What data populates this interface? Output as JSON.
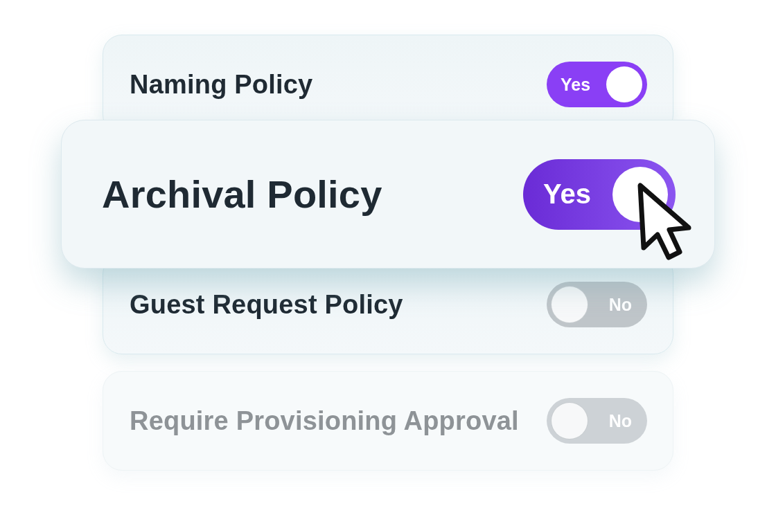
{
  "policies": [
    {
      "label": "Naming Policy",
      "highlighted": false,
      "disabled": false,
      "toggle": {
        "on": true,
        "text": "Yes"
      }
    },
    {
      "label": "Archival Policy",
      "highlighted": true,
      "disabled": false,
      "toggle": {
        "on": true,
        "text": "Yes"
      }
    },
    {
      "label": "Guest Request Policy",
      "highlighted": false,
      "disabled": false,
      "toggle": {
        "on": false,
        "text": "No"
      }
    },
    {
      "label": "Require Provisioning Approval",
      "highlighted": false,
      "disabled": true,
      "toggle": {
        "on": false,
        "text": "No"
      }
    }
  ]
}
